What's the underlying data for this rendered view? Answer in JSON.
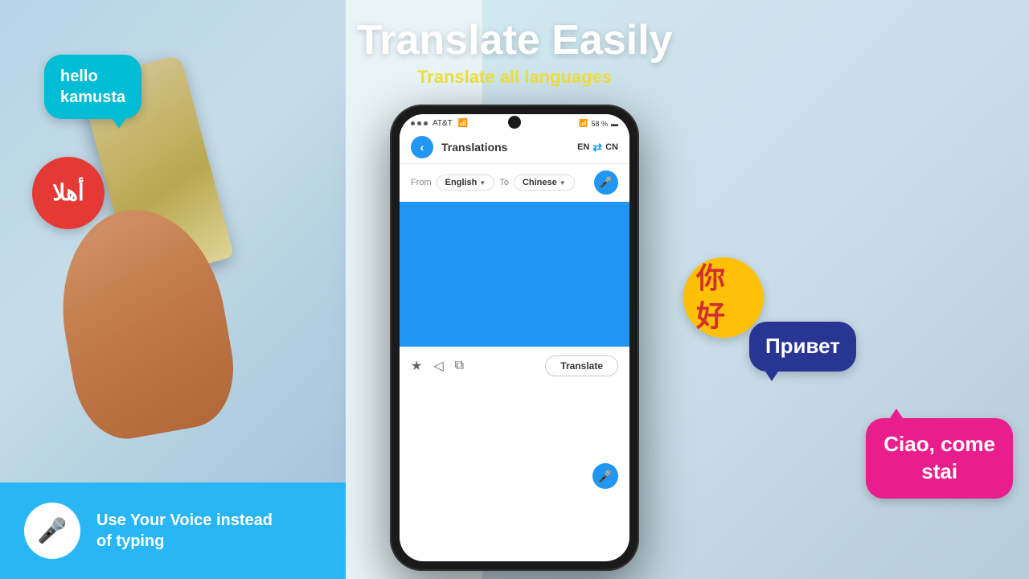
{
  "header": {
    "title": "Translate Easily",
    "subtitle": "Translate all languages"
  },
  "phone": {
    "status": {
      "carrier": "AT&T",
      "wifi": true,
      "battery": "58 %"
    },
    "app_bar": {
      "back_label": "‹",
      "title": "Translations",
      "lang_from": "EN",
      "lang_to": "CN",
      "swap_icon": "⇄"
    },
    "lang_selector": {
      "from_label": "From",
      "to_label": "To",
      "from_lang": "English",
      "to_lang": "Chinese",
      "dropdown_arrow": "▼"
    },
    "actions": {
      "star_icon": "★",
      "share_icon": "◁",
      "copy_icon": "⧉",
      "translate_btn": "Translate"
    },
    "mic_icon": "🎤"
  },
  "bubbles": {
    "hello": "hello\nkamusta",
    "arabic": "أهلا",
    "chinese": "你好",
    "russian": "Привет",
    "italian": "Ciao, come\nstai"
  },
  "bottom_banner": {
    "text": "Use Your Voice instead\nof typing"
  }
}
